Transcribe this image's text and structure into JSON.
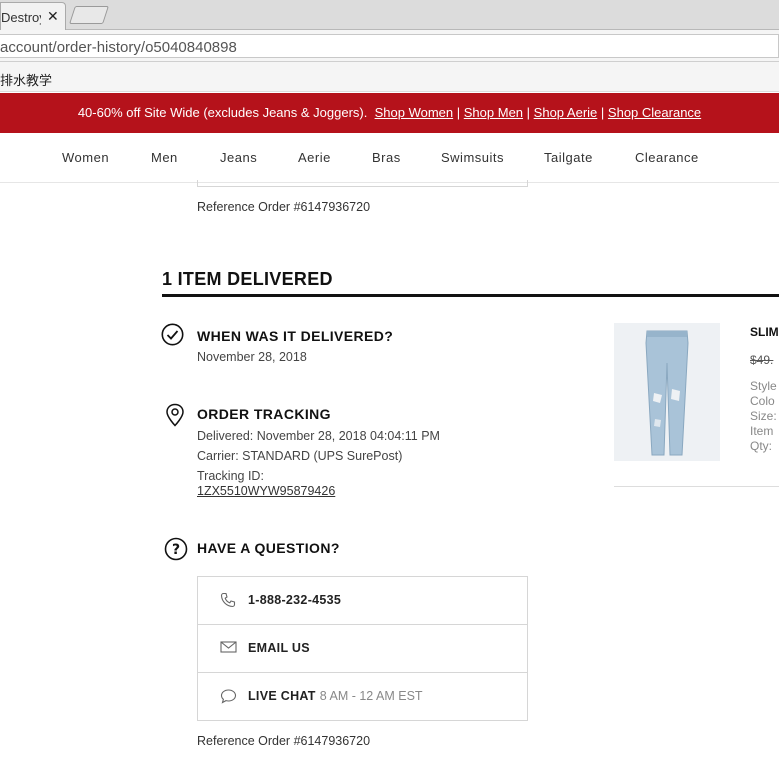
{
  "browser": {
    "tab_title": "Destroy",
    "tab_close": "✕",
    "address": "account/order-history/o5040840898",
    "bookmark": "排水教学"
  },
  "promo": {
    "text": "40-60% off Site Wide (excludes Jeans & Joggers).",
    "links": [
      "Shop Women",
      "Shop Men",
      "Shop Aerie",
      "Shop Clearance"
    ],
    "separator": "|",
    "background": "#b5121b"
  },
  "nav": {
    "items": [
      "Women",
      "Men",
      "Jeans",
      "Aerie",
      "Bras",
      "Swimsuits",
      "Tailgate",
      "Clearance"
    ]
  },
  "upper_reference": "Reference Order #6147936720",
  "delivered": {
    "title": "1 ITEM DELIVERED",
    "when": {
      "heading": "WHEN WAS IT DELIVERED?",
      "date": "November 28, 2018",
      "icon": "check-circle-icon"
    },
    "tracking": {
      "heading": "ORDER TRACKING",
      "delivered_line": "Delivered: November 28, 2018 04:04:11 PM",
      "carrier_line": "Carrier: STANDARD (UPS SurePost)",
      "tracking_label": "Tracking ID:",
      "tracking_id": "1ZX5510WYW95879426",
      "icon": "location-pin-icon"
    },
    "question": {
      "heading": "HAVE A QUESTION?",
      "icon": "question-circle-icon",
      "options": [
        {
          "label": "1-888-232-4535",
          "sub": "",
          "icon": "phone-icon"
        },
        {
          "label": "EMAIL US",
          "sub": "",
          "icon": "envelope-icon"
        },
        {
          "label": "LIVE CHAT",
          "sub": "8 AM - 12 AM EST",
          "icon": "chat-bubble-icon"
        }
      ]
    },
    "reference": "Reference Order #6147936720"
  },
  "product": {
    "name": "SLIM",
    "price": "$49.",
    "attributes": [
      "Style",
      "Colo",
      "Size:",
      "Item",
      "Qty:"
    ]
  }
}
